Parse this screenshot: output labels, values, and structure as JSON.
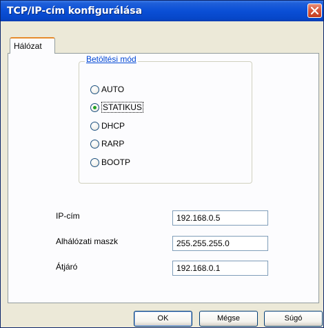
{
  "window": {
    "title": "TCP/IP-cím konfigurálása"
  },
  "tabs": [
    {
      "label": "Hálózat"
    }
  ],
  "load_mode": {
    "title": "Betöltési mód",
    "options": [
      {
        "label": "AUTO",
        "selected": false
      },
      {
        "label": "STATIKUS",
        "selected": true
      },
      {
        "label": "DHCP",
        "selected": false
      },
      {
        "label": "RARP",
        "selected": false
      },
      {
        "label": "BOOTP",
        "selected": false
      }
    ]
  },
  "fields": {
    "ip": {
      "label": "IP-cím",
      "value": "192.168.0.5"
    },
    "subnet": {
      "label": "Alhálózati maszk",
      "value": "255.255.255.0"
    },
    "gateway": {
      "label": "Átjáró",
      "value": "192.168.0.1"
    }
  },
  "buttons": {
    "ok": "OK",
    "cancel": "Mégse",
    "help": "Súgó"
  },
  "colors": {
    "accent": "#0A4FD6",
    "group_title": "#0046D5",
    "radio_selected": "#21A121"
  }
}
